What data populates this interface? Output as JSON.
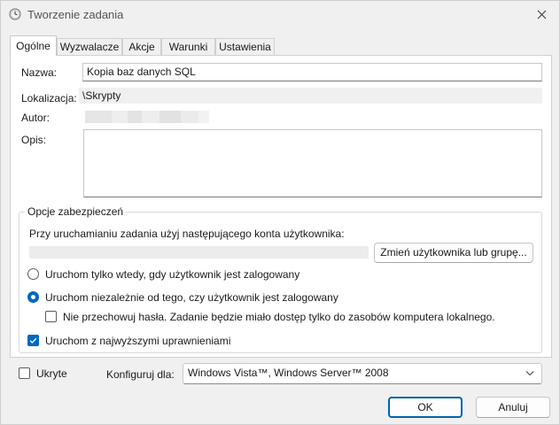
{
  "window": {
    "title": "Tworzenie zadania"
  },
  "tabs": [
    {
      "label": "Ogólne",
      "active": true
    },
    {
      "label": "Wyzwalacze",
      "active": false
    },
    {
      "label": "Akcje",
      "active": false
    },
    {
      "label": "Warunki",
      "active": false
    },
    {
      "label": "Ustawienia",
      "active": false
    }
  ],
  "general": {
    "name_label": "Nazwa:",
    "name_value": "Kopia baz danych SQL",
    "location_label": "Lokalizacja:",
    "location_value": "\\Skrypty",
    "author_label": "Autor:",
    "description_label": "Opis:",
    "description_value": ""
  },
  "security": {
    "group_title": "Opcje zabezpieczeń",
    "account_prompt": "Przy uruchamianiu zadania użyj następującego konta użytkownika:",
    "change_user_button": "Zmień użytkownika lub grupę...",
    "radio_logged_on": "Uruchom tylko wtedy, gdy użytkownik jest zalogowany",
    "radio_logged_on_checked": false,
    "radio_any": "Uruchom niezależnie od tego, czy użytkownik jest zalogowany",
    "radio_any_checked": true,
    "no_password_label": "Nie przechowuj hasła. Zadanie będzie miało dostęp tylko do zasobów komputera lokalnego.",
    "no_password_checked": false,
    "highest_privileges_label": "Uruchom z najwyższymi uprawnieniami",
    "highest_privileges_checked": true
  },
  "bottom": {
    "hidden_label": "Ukryte",
    "hidden_checked": false,
    "configure_label": "Konfiguruj dla:",
    "configure_value": "Windows Vista™, Windows Server™ 2008"
  },
  "buttons": {
    "ok": "OK",
    "cancel": "Anuluj"
  },
  "colors": {
    "accent": "#0067c0"
  }
}
